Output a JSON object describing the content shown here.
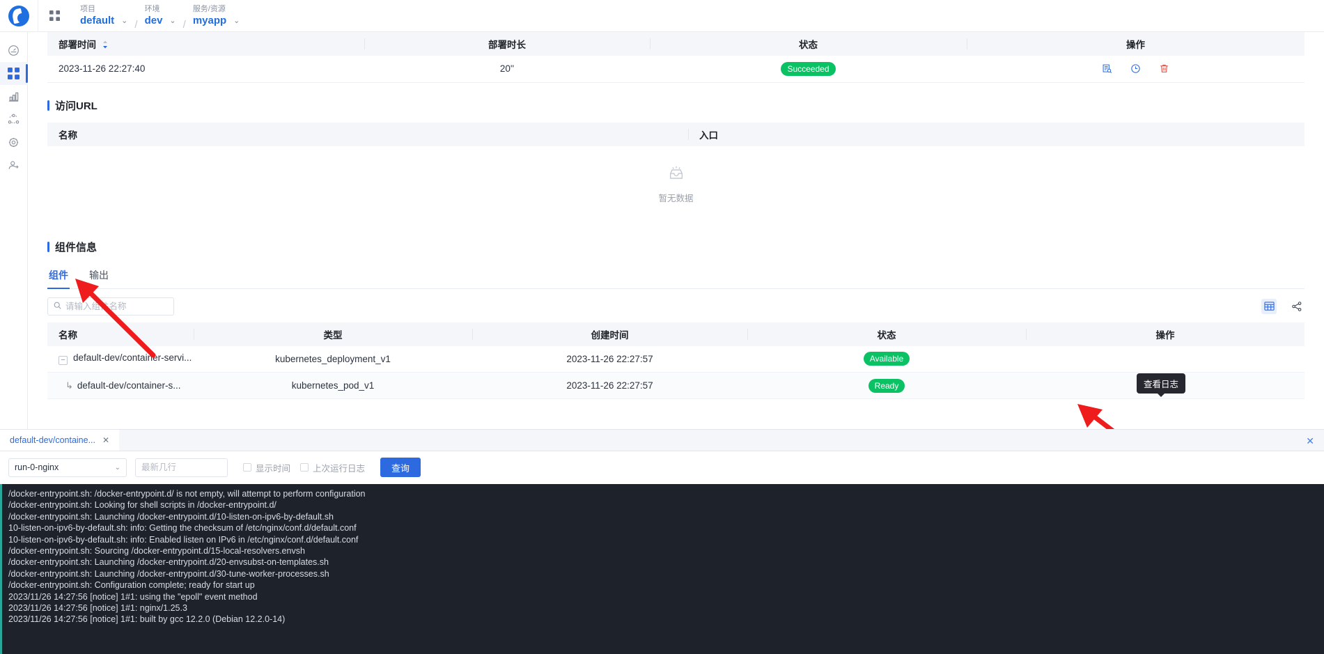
{
  "topbar": {
    "logo_icon": "app-logo-icon",
    "apps_icon": "apps-grid-icon",
    "breadcrumbs": [
      {
        "label": "项目",
        "value": "default",
        "caret": "⌄"
      },
      {
        "label": "环境",
        "value": "dev",
        "caret": "⌄"
      },
      {
        "label": "服务/资源",
        "value": "myapp",
        "caret": "⌄"
      }
    ],
    "separator": "/"
  },
  "sidebar": {
    "items": [
      {
        "name": "dashboard",
        "icon": "dashboard-icon",
        "active": false
      },
      {
        "name": "applications",
        "icon": "apps-grid-icon",
        "active": true
      },
      {
        "name": "monitoring",
        "icon": "bar-chart-icon",
        "active": false
      },
      {
        "name": "topology",
        "icon": "network-nodes-icon",
        "active": false
      },
      {
        "name": "settings",
        "icon": "gear-icon",
        "active": false
      },
      {
        "name": "members",
        "icon": "users-icon",
        "active": false
      }
    ]
  },
  "deploy_table": {
    "columns": [
      "部署时间",
      "部署时长",
      "状态",
      "操作"
    ],
    "sort_indicator": "sort-arrows-icon",
    "rows": [
      {
        "deploy_time": "2023-11-26 22:27:40",
        "duration": "20''",
        "status": "Succeeded",
        "actions": [
          "view-log-icon",
          "history-clock-icon",
          "delete-trash-icon"
        ]
      }
    ]
  },
  "url_section": {
    "title": "访问URL",
    "columns": [
      "名称",
      "入口"
    ],
    "empty_icon": "empty-inbox-icon",
    "empty_text": "暂无数据"
  },
  "component_section": {
    "title": "组件信息",
    "tabs": [
      {
        "label": "组件",
        "active": true
      },
      {
        "label": "输出",
        "active": false
      }
    ],
    "search": {
      "placeholder": "请输入组件名称",
      "value": "",
      "icon": "search-icon"
    },
    "view_toggles": [
      {
        "name": "table-view",
        "icon": "table-grid-icon",
        "active": true
      },
      {
        "name": "topology-view",
        "icon": "share-nodes-icon",
        "active": false
      }
    ],
    "columns": [
      "名称",
      "类型",
      "创建时间",
      "状态",
      "操作"
    ],
    "rows": [
      {
        "toggle": "−",
        "name": "default-dev/container-servi...",
        "type": "kubernetes_deployment_v1",
        "created": "2023-11-26 22:27:57",
        "status": "Available",
        "actions": []
      },
      {
        "toggle": "↳",
        "name": "default-dev/container-s...",
        "type": "kubernetes_pod_v1",
        "created": "2023-11-26 22:27:57",
        "status": "Ready",
        "actions": [
          "view-log-icon",
          "view-yaml-icon"
        ]
      }
    ],
    "tooltip": "查看日志"
  },
  "log_panel": {
    "tab_label": "default-dev/containe...",
    "tab_close": "✕",
    "panel_close": "✕",
    "container_select": {
      "value": "run-0-nginx",
      "caret": "⌄"
    },
    "lines_input": {
      "placeholder": "最新几行",
      "value": ""
    },
    "checkboxes": [
      {
        "label": "显示时间",
        "checked": false
      },
      {
        "label": "上次运行日志",
        "checked": false
      }
    ],
    "query_button": "查询",
    "lines": [
      "/docker-entrypoint.sh: /docker-entrypoint.d/ is not empty, will attempt to perform configuration",
      "/docker-entrypoint.sh: Looking for shell scripts in /docker-entrypoint.d/",
      "/docker-entrypoint.sh: Launching /docker-entrypoint.d/10-listen-on-ipv6-by-default.sh",
      "10-listen-on-ipv6-by-default.sh: info: Getting the checksum of /etc/nginx/conf.d/default.conf",
      "10-listen-on-ipv6-by-default.sh: info: Enabled listen on IPv6 in /etc/nginx/conf.d/default.conf",
      "/docker-entrypoint.sh: Sourcing /docker-entrypoint.d/15-local-resolvers.envsh",
      "/docker-entrypoint.sh: Launching /docker-entrypoint.d/20-envsubst-on-templates.sh",
      "/docker-entrypoint.sh: Launching /docker-entrypoint.d/30-tune-worker-processes.sh",
      "/docker-entrypoint.sh: Configuration complete; ready for start up",
      "2023/11/26 14:27:56 [notice] 1#1: using the \"epoll\" event method",
      "2023/11/26 14:27:56 [notice] 1#1: nginx/1.25.3",
      "2023/11/26 14:27:56 [notice] 1#1: built by gcc 12.2.0 (Debian 12.2.0-14)"
    ]
  },
  "colors": {
    "brand_blue": "#2d6ae0",
    "success_green": "#0ac264",
    "danger_red": "#e8453c",
    "annotation_red": "#ee1c1c",
    "log_bg": "#1e222b",
    "header_bg": "#f4f6fa"
  },
  "annotations": [
    {
      "name": "arrow-to-component-tab"
    },
    {
      "name": "arrow-to-view-log-icon"
    }
  ]
}
